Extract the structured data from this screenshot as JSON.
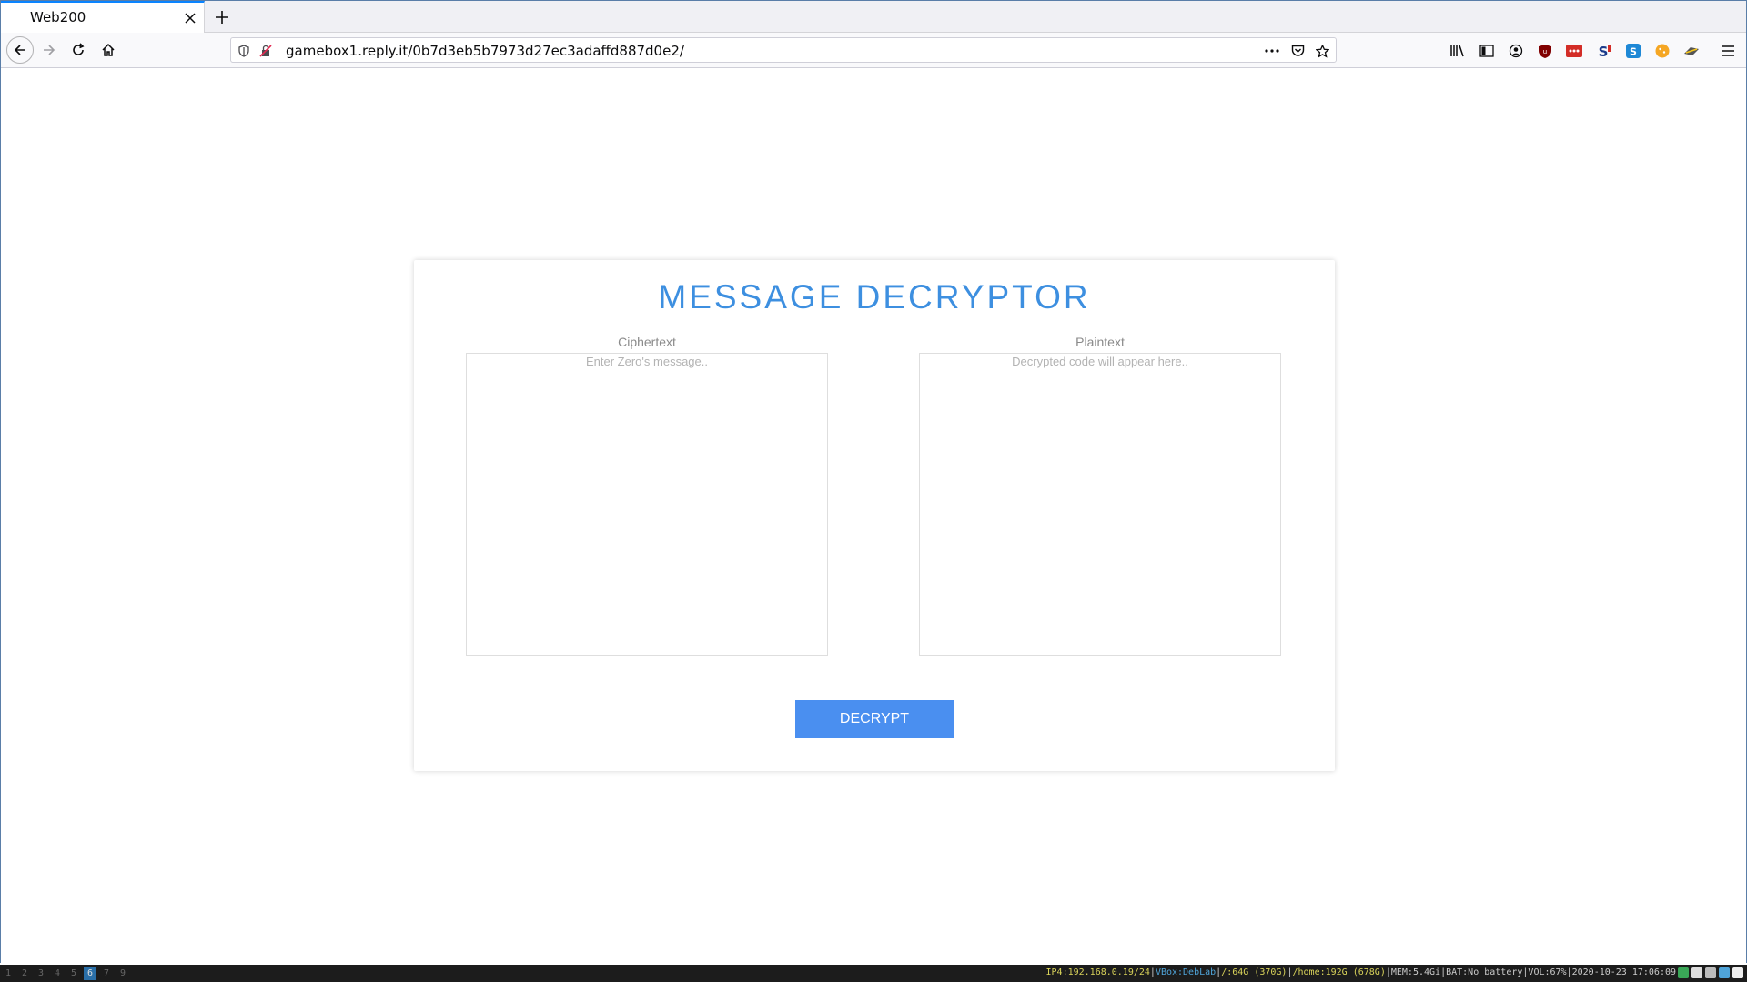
{
  "browser": {
    "tab_title": "Web200",
    "url": "gamebox1.reply.it/0b7d3eb5b7973d27ec3adaffd887d0e2/",
    "accent_color": "#0a84ff"
  },
  "page": {
    "title": "MESSAGE DECRYPTOR",
    "title_color": "#3d8fe0",
    "ciphertext": {
      "label": "Ciphertext",
      "placeholder": "Enter Zero's message..",
      "value": ""
    },
    "plaintext": {
      "label": "Plaintext",
      "placeholder": "Decrypted code will appear here..",
      "value": ""
    },
    "decrypt_button": {
      "label": "DECRYPT",
      "color": "#4a8ff0"
    }
  },
  "statusbar": {
    "workspaces": [
      "1",
      "2",
      "3",
      "4",
      "5",
      "6",
      "7",
      "9"
    ],
    "active_workspace": "6",
    "ip": "IP4:192.168.0.19/24",
    "vbox": "VBox:DebLab",
    "root_disk": "/:64G (370G)",
    "home_disk": "/home:192G (678G)",
    "mem": "MEM:5.4Gi",
    "bat": "BAT:No battery",
    "vol": "VOL:67%",
    "datetime": "2020-10-23 17:06:09",
    "separator": "|"
  }
}
